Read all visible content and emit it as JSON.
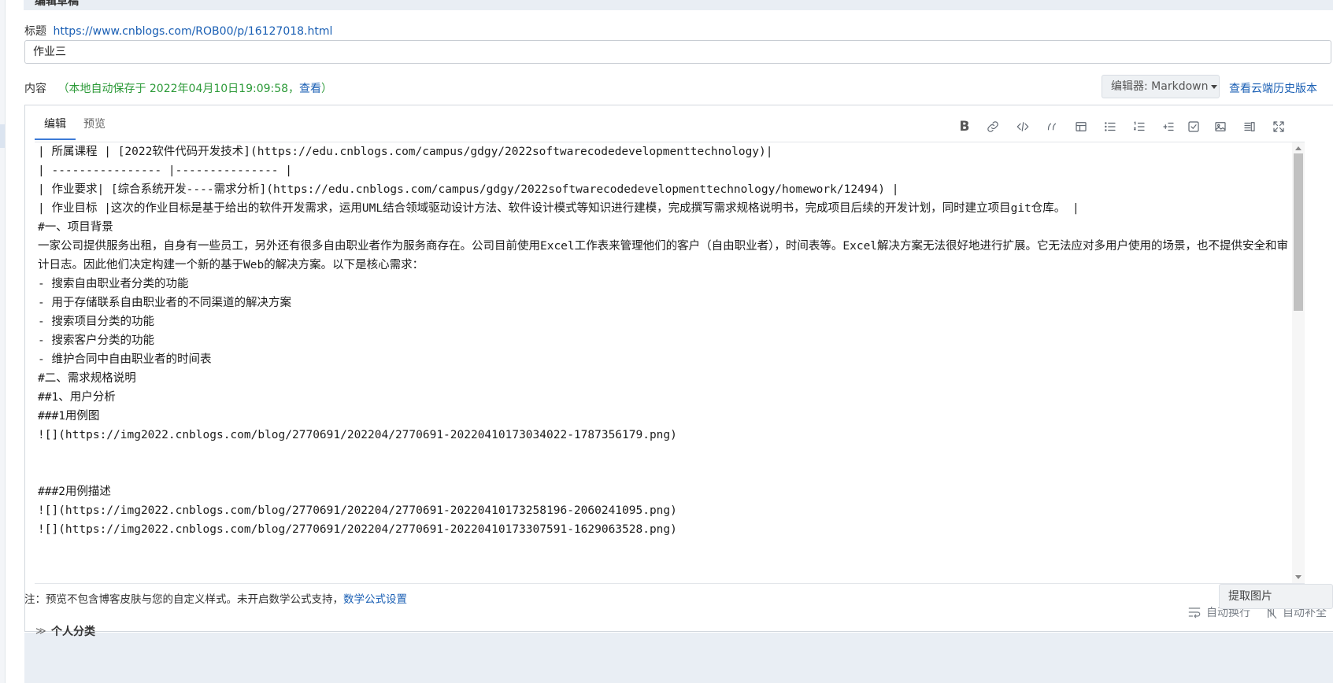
{
  "top_section": {
    "title": "编辑草稿"
  },
  "title_field": {
    "label": "标题",
    "url": "https://www.cnblogs.com/ROB00/p/16127018.html",
    "value": "作业三"
  },
  "content_field": {
    "label": "内容",
    "autosave_prefix": "（本地自动保存于 2022年04月10日19:09:58，",
    "autosave_link": "查看",
    "autosave_suffix": "）"
  },
  "editor_select": {
    "label": "编辑器: Markdown"
  },
  "history_link": "查看云端历史版本",
  "tabs": [
    {
      "label": "编辑",
      "active": true
    },
    {
      "label": "预览",
      "active": false
    }
  ],
  "toolbar_icons": [
    "bold-icon",
    "link-icon",
    "code-icon",
    "quote-icon",
    "table-icon",
    "unordered-list-icon",
    "ordered-list-icon",
    "indent-icon",
    "checkbox-icon",
    "image-icon",
    "split-view-icon",
    "fullscreen-icon"
  ],
  "lines": [
    "| 所属课程 | [2022软件代码开发技术](https://edu.cnblogs.com/campus/gdgy/2022softwarecodedevelopmenttechnology)|",
    "| ---------------- |--------------- |",
    "| 作业要求| [综合系统开发----需求分析](https://edu.cnblogs.com/campus/gdgy/2022softwarecodedevelopmenttechnology/homework/12494) |",
    "| 作业目标 |这次的作业目标是基于给出的软件开发需求，运用UML结合领域驱动设计方法、软件设计模式等知识进行建模，完成撰写需求规格说明书，完成项目后续的开发计划，同时建立项目git仓库。 |",
    "#一、项目背景",
    "一家公司提供服务出租，自身有一些员工，另外还有很多自由职业者作为服务商存在。公司目前使用Excel工作表来管理他们的客户（自由职业者），时间表等。Excel解决方案无法很好地进行扩展。它无法应对多用户使用的场景，也不提供安全和审计日志。因此他们决定构建一个新的基于Web的解决方案。以下是核心需求：",
    "  - 搜索自由职业者分类的功能",
    "  - 用于存储联系自由职业者的不同渠道的解决方案",
    "  - 搜索项目分类的功能",
    "  - 搜索客户分类的功能",
    "  - 维护合同中自由职业者的时间表",
    "#二、需求规格说明",
    "##1、用户分析",
    "###1用例图",
    "![](https://img2022.cnblogs.com/blog/2770691/202204/2770691-20220410173034022-1787356179.png)",
    "",
    "",
    "###2用例描述",
    "![](https://img2022.cnblogs.com/blog/2770691/202204/2770691-20220410173258196-2060241095.png)",
    "![](https://img2022.cnblogs.com/blog/2770691/202204/2770691-20220410173307591-1629063528.png)"
  ],
  "footer_tools": {
    "auto_wrap": "自动换行",
    "auto_complete": "自动补全"
  },
  "note": {
    "text": "注：预览不包含博客皮肤与您的自定义样式。未开启数学公式支持，",
    "link": "数学公式设置"
  },
  "extract_button": "提取图片",
  "bottom_section": {
    "title": "个人分类"
  }
}
